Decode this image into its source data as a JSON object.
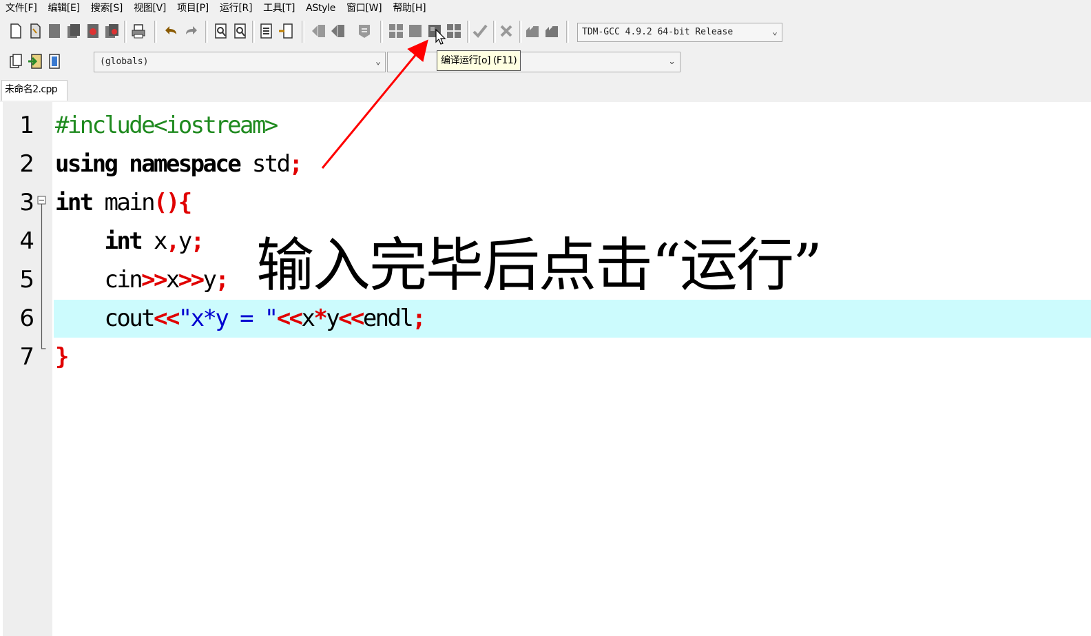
{
  "menu": [
    "文件[F]",
    "编辑[E]",
    "搜索[S]",
    "视图[V]",
    "项目[P]",
    "运行[R]",
    "工具[T]",
    "AStyle",
    "窗口[W]",
    "帮助[H]"
  ],
  "toolbar": {
    "compiler": "TDM-GCC 4.9.2 64-bit Release",
    "scope": "(globals)",
    "tooltip": "编译运行[o] (F11)"
  },
  "tab": {
    "label": "未命名2.cpp"
  },
  "editor": {
    "line_numbers": [
      "1",
      "2",
      "3",
      "4",
      "5",
      "6",
      "7"
    ],
    "lines": [
      [
        {
          "t": "#include<iostream>",
          "c": "pre"
        }
      ],
      [
        {
          "t": "using",
          "c": "kw"
        },
        {
          "t": " ",
          "c": "tx"
        },
        {
          "t": "namespace",
          "c": "kw"
        },
        {
          "t": " std",
          "c": "tx"
        },
        {
          "t": ";",
          "c": "op"
        }
      ],
      [
        {
          "t": "int",
          "c": "kw"
        },
        {
          "t": " main",
          "c": "tx"
        },
        {
          "t": "(){",
          "c": "op"
        }
      ],
      [
        {
          "t": "    ",
          "c": "tx"
        },
        {
          "t": "int",
          "c": "kw"
        },
        {
          "t": " x",
          "c": "tx"
        },
        {
          "t": ",",
          "c": "op"
        },
        {
          "t": "y",
          "c": "tx"
        },
        {
          "t": ";",
          "c": "op"
        }
      ],
      [
        {
          "t": "    cin",
          "c": "tx"
        },
        {
          "t": ">>",
          "c": "op"
        },
        {
          "t": "x",
          "c": "tx"
        },
        {
          "t": ">>",
          "c": "op"
        },
        {
          "t": "y",
          "c": "tx"
        },
        {
          "t": ";",
          "c": "op"
        }
      ],
      [
        {
          "t": "    cout",
          "c": "tx"
        },
        {
          "t": "<<",
          "c": "op"
        },
        {
          "t": "\"x*y = \"",
          "c": "str"
        },
        {
          "t": "<<",
          "c": "op"
        },
        {
          "t": "x",
          "c": "tx"
        },
        {
          "t": "*",
          "c": "op"
        },
        {
          "t": "y",
          "c": "tx"
        },
        {
          "t": "<<",
          "c": "op"
        },
        {
          "t": "endl",
          "c": "tx"
        },
        {
          "t": ";",
          "c": "op"
        }
      ],
      [
        {
          "t": "}",
          "c": "op"
        }
      ]
    ],
    "highlighted_line": 6
  },
  "annotation": "输入完毕后点击“运行”",
  "colors": {
    "highlight": "#ccfbfd",
    "arrow": "#ff0000",
    "preprocessor": "#1f8a1f",
    "operator": "#e00000",
    "string": "#0000d0"
  }
}
